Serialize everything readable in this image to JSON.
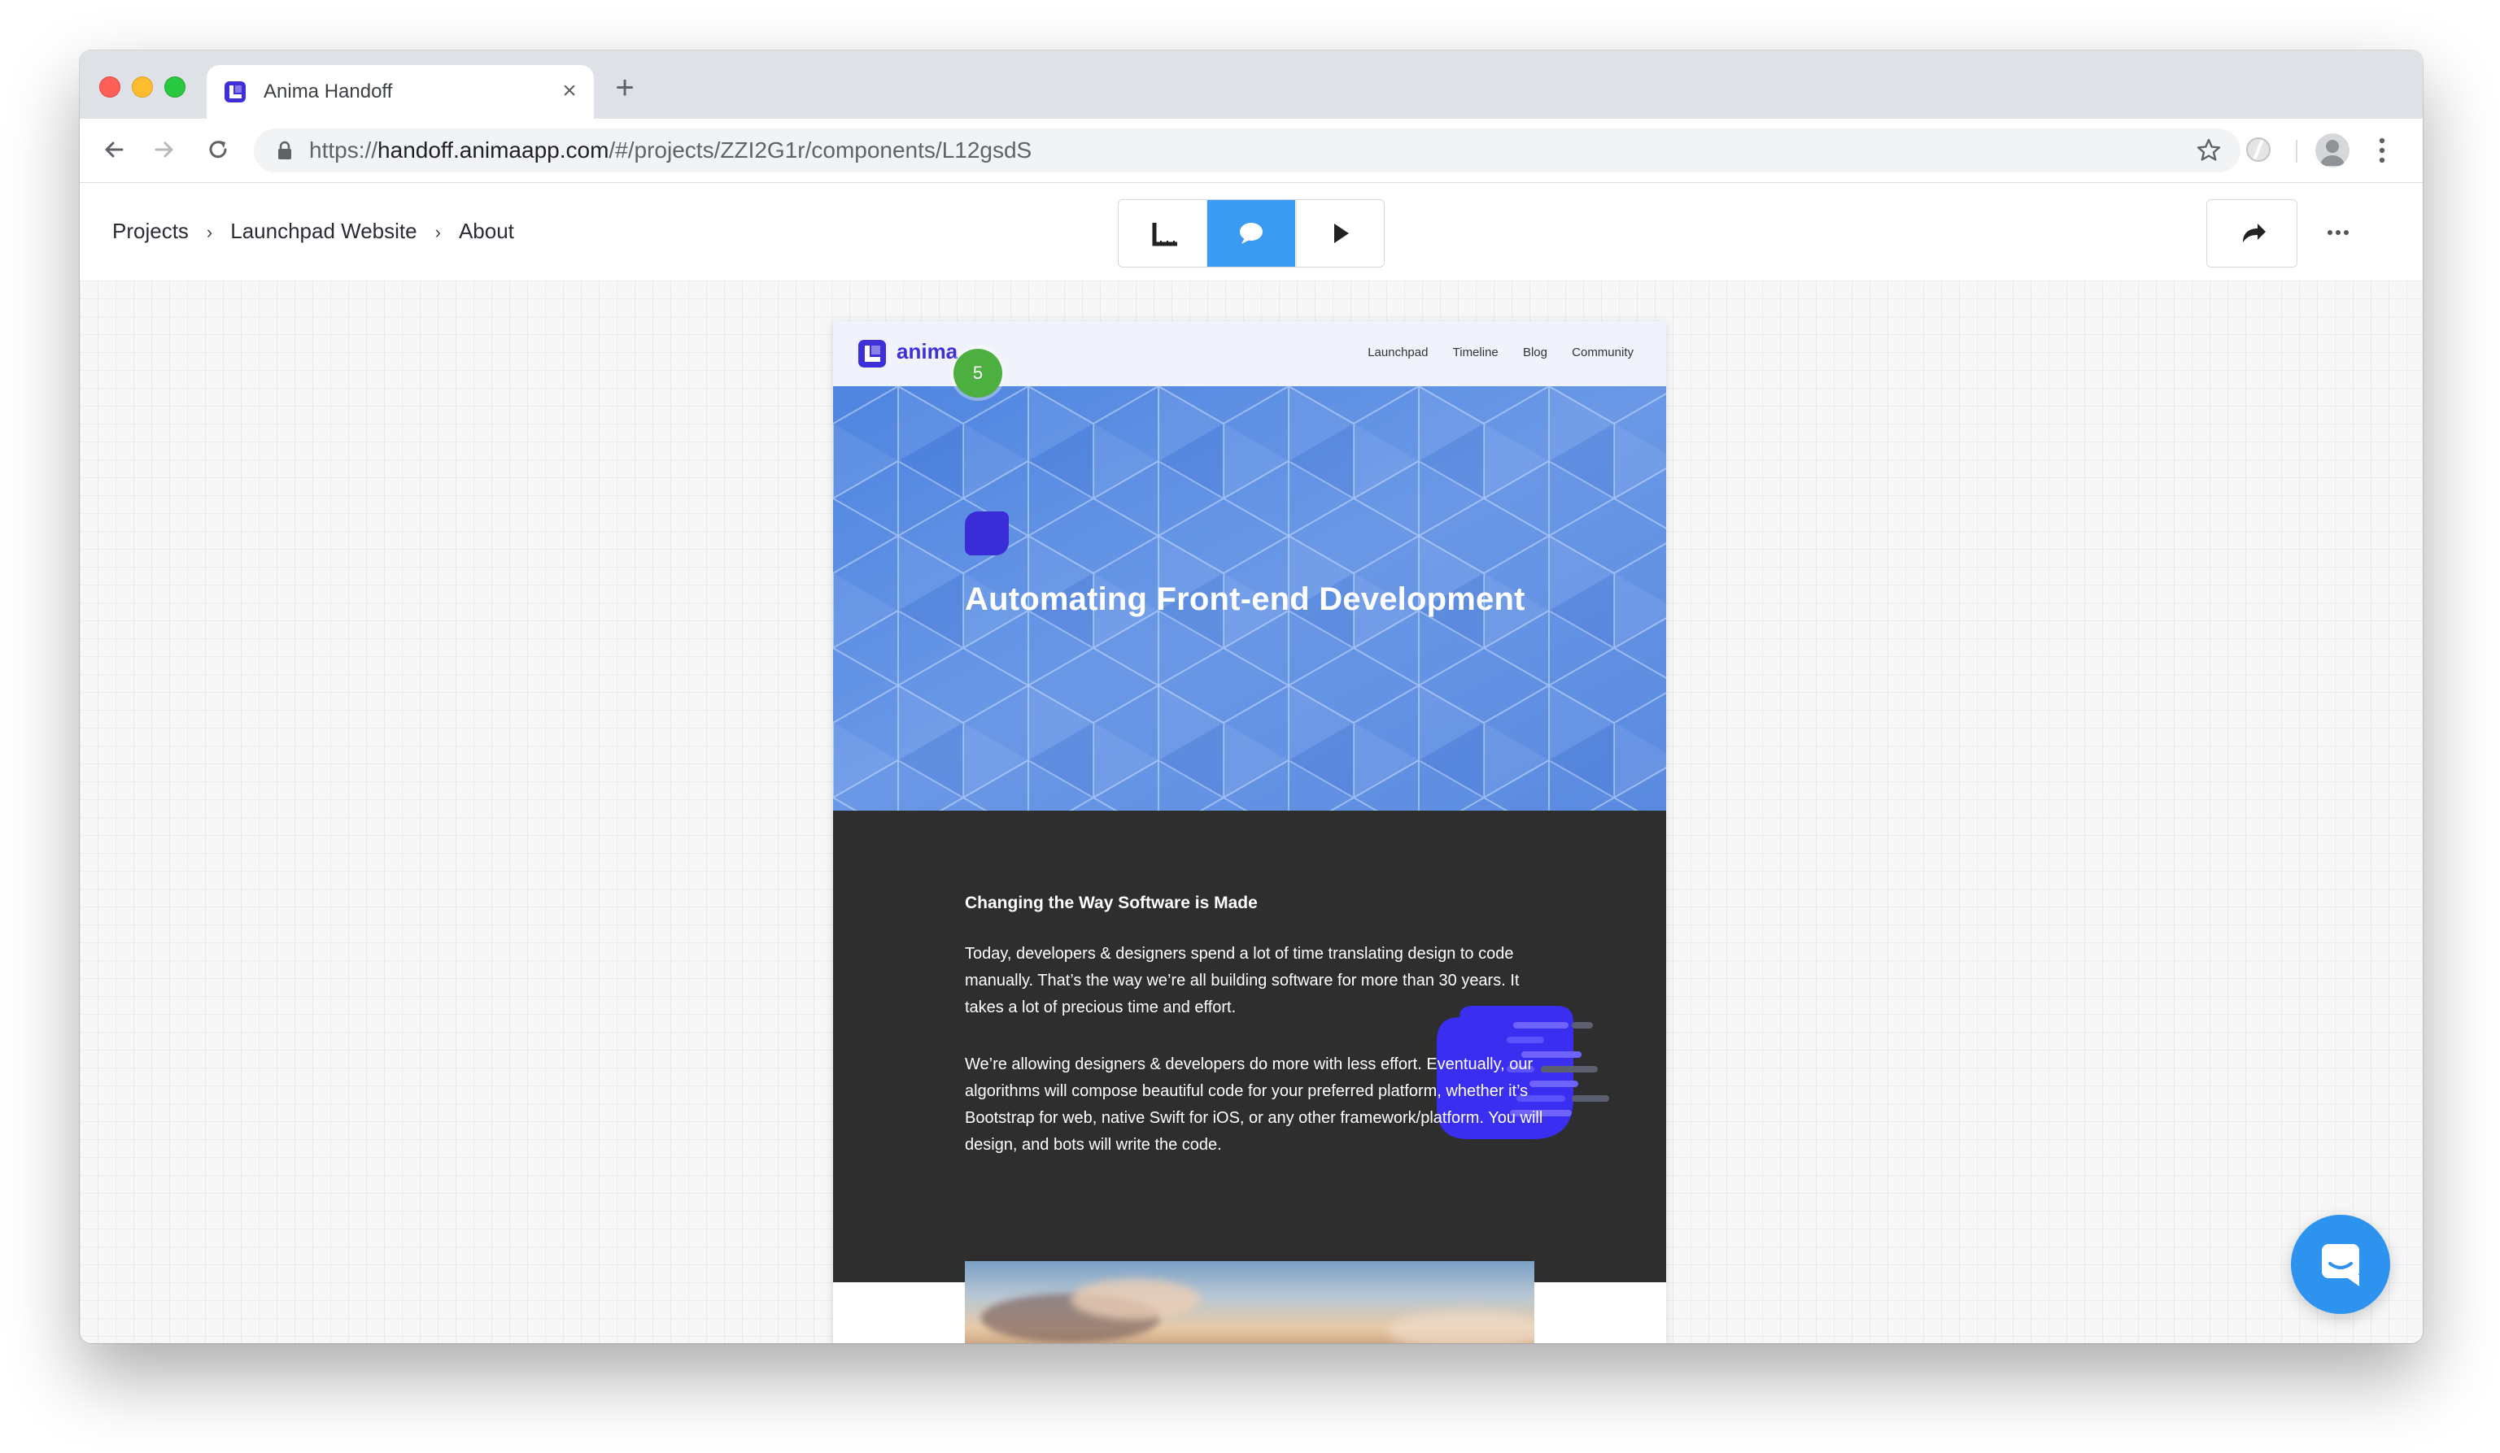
{
  "browser": {
    "tab_title": "Anima Handoff",
    "tab_close_glyph": "×",
    "new_tab_glyph": "+",
    "url_scheme": "https://",
    "url_host": "handoff.animaapp.com",
    "url_path": "/#/projects/ZZI2G1r/components/L12gsdS",
    "icons": [
      "back-arrow-icon",
      "forward-arrow-icon",
      "reload-icon",
      "lock-icon",
      "star-icon",
      "extension-icon",
      "profile-avatar-icon",
      "kebab-menu-icon"
    ]
  },
  "app": {
    "breadcrumb": {
      "items": [
        "Projects",
        "Launchpad Website",
        "About"
      ],
      "separator": "›"
    },
    "modes": {
      "active": "comments",
      "items": [
        "inspect",
        "comments",
        "preview"
      ]
    },
    "accent_color": "#3b9bf2"
  },
  "artboard": {
    "nav": {
      "logo_text": "anima",
      "links": [
        "Launchpad",
        "Timeline",
        "Blog",
        "Community"
      ]
    },
    "comment_pin": {
      "count": "5",
      "color": "#4caf3f"
    },
    "hero": {
      "title": "Automating Front-end Development",
      "badge_color": "#3a2cd6"
    },
    "section": {
      "heading": "Changing the Way Software is Made",
      "paragraph1": "Today, developers & designers spend a lot of time translating design to code manually. That’s the way we’re all building software for more than 30 years. It takes a lot of precious time and effort.",
      "paragraph2": "We’re allowing designers & developers do more with less effort. Eventually, our algorithms will compose beautiful code for your preferred platform, whether it’s Bootstrap for web, native Swift for iOS, or any other framework/platform. You will design, and bots will write the code."
    }
  },
  "chat_widget": {
    "icon": "chat-bubble-icon",
    "color": "#2d93ef"
  }
}
